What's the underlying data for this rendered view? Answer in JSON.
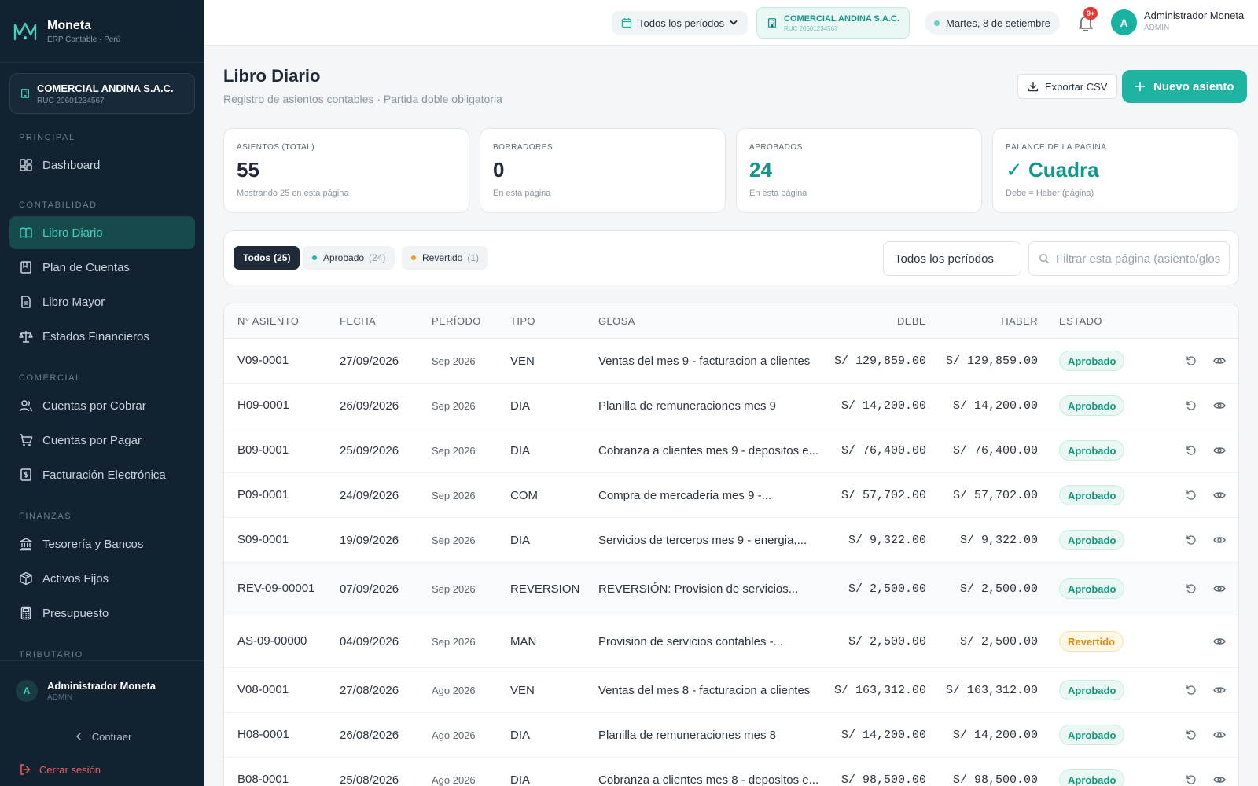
{
  "app": {
    "name": "Moneta",
    "subtitle": "ERP Contable · Perú"
  },
  "company": {
    "name": "COMERCIAL ANDINA S.A.C.",
    "ruc": "RUC 20601234567"
  },
  "sidebar": {
    "sections": {
      "principal": "PRINCIPAL",
      "contabilidad": "CONTABILIDAD",
      "comercial": "COMERCIAL",
      "finanzas": "FINANZAS",
      "tributario": "TRIBUTARIO"
    },
    "items": {
      "dashboard": "Dashboard",
      "libro_diario": "Libro Diario",
      "plan_cuentas": "Plan de Cuentas",
      "libro_mayor": "Libro Mayor",
      "estados_financieros": "Estados Financieros",
      "cuentas_cobrar": "Cuentas por Cobrar",
      "cuentas_pagar": "Cuentas por Pagar",
      "facturacion": "Facturación Electrónica",
      "tesoreria": "Tesorería y Bancos",
      "activos": "Activos Fijos",
      "presupuesto": "Presupuesto"
    },
    "user": {
      "initial": "A",
      "name": "Administrador Moneta",
      "role": "ADMIN"
    },
    "collapse": "Contraer",
    "logout": "Cerrar sesión"
  },
  "topbar": {
    "period": "Todos los períodos",
    "company_name": "COMERCIAL ANDINA S.A.C.",
    "company_ruc": "RUC 20601234567",
    "date": "Martes, 8 de setiembre",
    "notifications": "9+",
    "user_initial": "A",
    "user_name": "Administrador Moneta",
    "user_role": "ADMIN"
  },
  "page": {
    "title": "Libro Diario",
    "subtitle": "Registro de asientos contables · Partida doble obligatoria",
    "export_label": "Exportar CSV",
    "new_label": "Nuevo asiento"
  },
  "stats": {
    "total": {
      "label": "ASIENTOS (TOTAL)",
      "value": "55",
      "note": "Mostrando 25 en esta página"
    },
    "drafts": {
      "label": "BORRADORES",
      "value": "0",
      "note": "En esta página"
    },
    "approved": {
      "label": "APROBADOS",
      "value": "24",
      "note": "En esta página"
    },
    "balance": {
      "label": "BALANCE DE LA PÁGINA",
      "value": "✓ Cuadra",
      "note": "Debe = Haber (página)"
    }
  },
  "filters": {
    "all": {
      "label": "Todos",
      "count": "(25)"
    },
    "approved": {
      "label": "Aprobado",
      "count": "(24)"
    },
    "reverted": {
      "label": "Revertido",
      "count": "(1)"
    },
    "period_select": "Todos los períodos",
    "search_placeholder": "Filtrar esta página (asiento/glosa)"
  },
  "table": {
    "headers": {
      "asiento": "N° ASIENTO",
      "fecha": "FECHA",
      "periodo": "PERÍODO",
      "tipo": "TIPO",
      "glosa": "GLOSA",
      "debe": "DEBE",
      "haber": "HABER",
      "estado": "ESTADO"
    },
    "rows": [
      {
        "asiento": "V09-0001",
        "fecha": "27/09/2026",
        "periodo": "Sep 2026",
        "tipo": "VEN",
        "glosa": "Ventas del mes 9 - facturacion a clientes",
        "debe": "S/ 129,859.00",
        "haber": "S/ 129,859.00",
        "estado": "Aprobado"
      },
      {
        "asiento": "H09-0001",
        "fecha": "26/09/2026",
        "periodo": "Sep 2026",
        "tipo": "DIA",
        "glosa": "Planilla de remuneraciones mes 9",
        "debe": "S/ 14,200.00",
        "haber": "S/ 14,200.00",
        "estado": "Aprobado"
      },
      {
        "asiento": "B09-0001",
        "fecha": "25/09/2026",
        "periodo": "Sep 2026",
        "tipo": "DIA",
        "glosa": "Cobranza a clientes mes 9 - depositos e...",
        "debe": "S/ 76,400.00",
        "haber": "S/ 76,400.00",
        "estado": "Aprobado"
      },
      {
        "asiento": "P09-0001",
        "fecha": "24/09/2026",
        "periodo": "Sep 2026",
        "tipo": "COM",
        "glosa": "Compra de mercaderia mes 9 -...",
        "debe": "S/ 57,702.00",
        "haber": "S/ 57,702.00",
        "estado": "Aprobado"
      },
      {
        "asiento": "S09-0001",
        "fecha": "19/09/2026",
        "periodo": "Sep 2026",
        "tipo": "DIA",
        "glosa": "Servicios de terceros mes 9 - energia,...",
        "debe": "S/ 9,322.00",
        "haber": "S/ 9,322.00",
        "estado": "Aprobado"
      },
      {
        "asiento": "REV-09-00001",
        "fecha": "07/09/2026",
        "periodo": "Sep 2026",
        "tipo": "REVERSION",
        "glosa": "REVERSIÓN: Provision de servicios...",
        "debe": "S/ 2,500.00",
        "haber": "S/ 2,500.00",
        "estado": "Aprobado"
      },
      {
        "asiento": "AS-09-00000",
        "fecha": "04/09/2026",
        "periodo": "Sep 2026",
        "tipo": "MAN",
        "glosa": "Provision de servicios contables -...",
        "debe": "S/ 2,500.00",
        "haber": "S/ 2,500.00",
        "estado": "Revertido"
      },
      {
        "asiento": "V08-0001",
        "fecha": "27/08/2026",
        "periodo": "Ago 2026",
        "tipo": "VEN",
        "glosa": "Ventas del mes 8 - facturacion a clientes",
        "debe": "S/ 163,312.00",
        "haber": "S/ 163,312.00",
        "estado": "Aprobado"
      },
      {
        "asiento": "H08-0001",
        "fecha": "26/08/2026",
        "periodo": "Ago 2026",
        "tipo": "DIA",
        "glosa": "Planilla de remuneraciones mes 8",
        "debe": "S/ 14,200.00",
        "haber": "S/ 14,200.00",
        "estado": "Aprobado"
      },
      {
        "asiento": "B08-0001",
        "fecha": "25/08/2026",
        "periodo": "Ago 2026",
        "tipo": "DIA",
        "glosa": "Cobranza a clientes mes 8 - depositos e...",
        "debe": "S/ 98,500.00",
        "haber": "S/ 98,500.00",
        "estado": "Aprobado"
      }
    ]
  },
  "colors": {
    "accent": "#1fb3a2",
    "sidebar": "#122230",
    "approved": "#14977f",
    "reverted": "#d98a0b"
  }
}
